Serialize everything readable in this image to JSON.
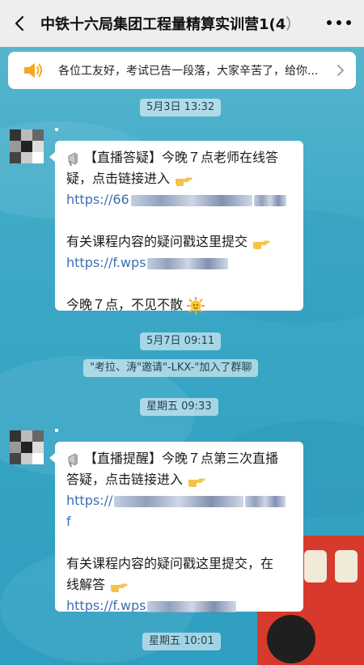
{
  "header": {
    "title": "中铁十六局集团工程量精算实训营1(4",
    "title_tail": "）"
  },
  "notice": {
    "text": "各位工友好，考试已告一段落，大家辛苦了，给你..."
  },
  "timestamps": [
    "5月3日 13:32",
    "5月7日 09:11",
    "星期五 09:33",
    "星期五 10:01"
  ],
  "system_message": "\"考拉、涛\"邀请\"-LKX-\"加入了群聊",
  "messages": [
    {
      "lines": [
        "【直播答疑】今晚７点老师在线答",
        "疑，点击链接进入",
        "https://66",
        "",
        "有关课程内容的疑问戳这里提交",
        "https://f.wps",
        "",
        "今晚７点，不见不散"
      ]
    },
    {
      "lines": [
        "【直播提醒】今晚７点第三次直播",
        "答疑，点击链接进入",
        "https://",
        "f",
        "",
        "有关课程内容的疑问戳这里提交，在",
        "线解答",
        "https://f.wps"
      ]
    }
  ],
  "icons": {
    "back": "chevron-left-icon",
    "more": "more-dots-icon",
    "notice": "speaker-icon",
    "notice_arrow": "chevron-right-icon",
    "megaphone": "megaphone-icon",
    "point": "pointing-hand-icon",
    "sun": "sun-face-icon"
  },
  "colors": {
    "header_bg": "#eeeeee",
    "link": "#3d6fb3",
    "notice_icon": "#f5a623",
    "chat_bg": "#3aa9c5"
  }
}
